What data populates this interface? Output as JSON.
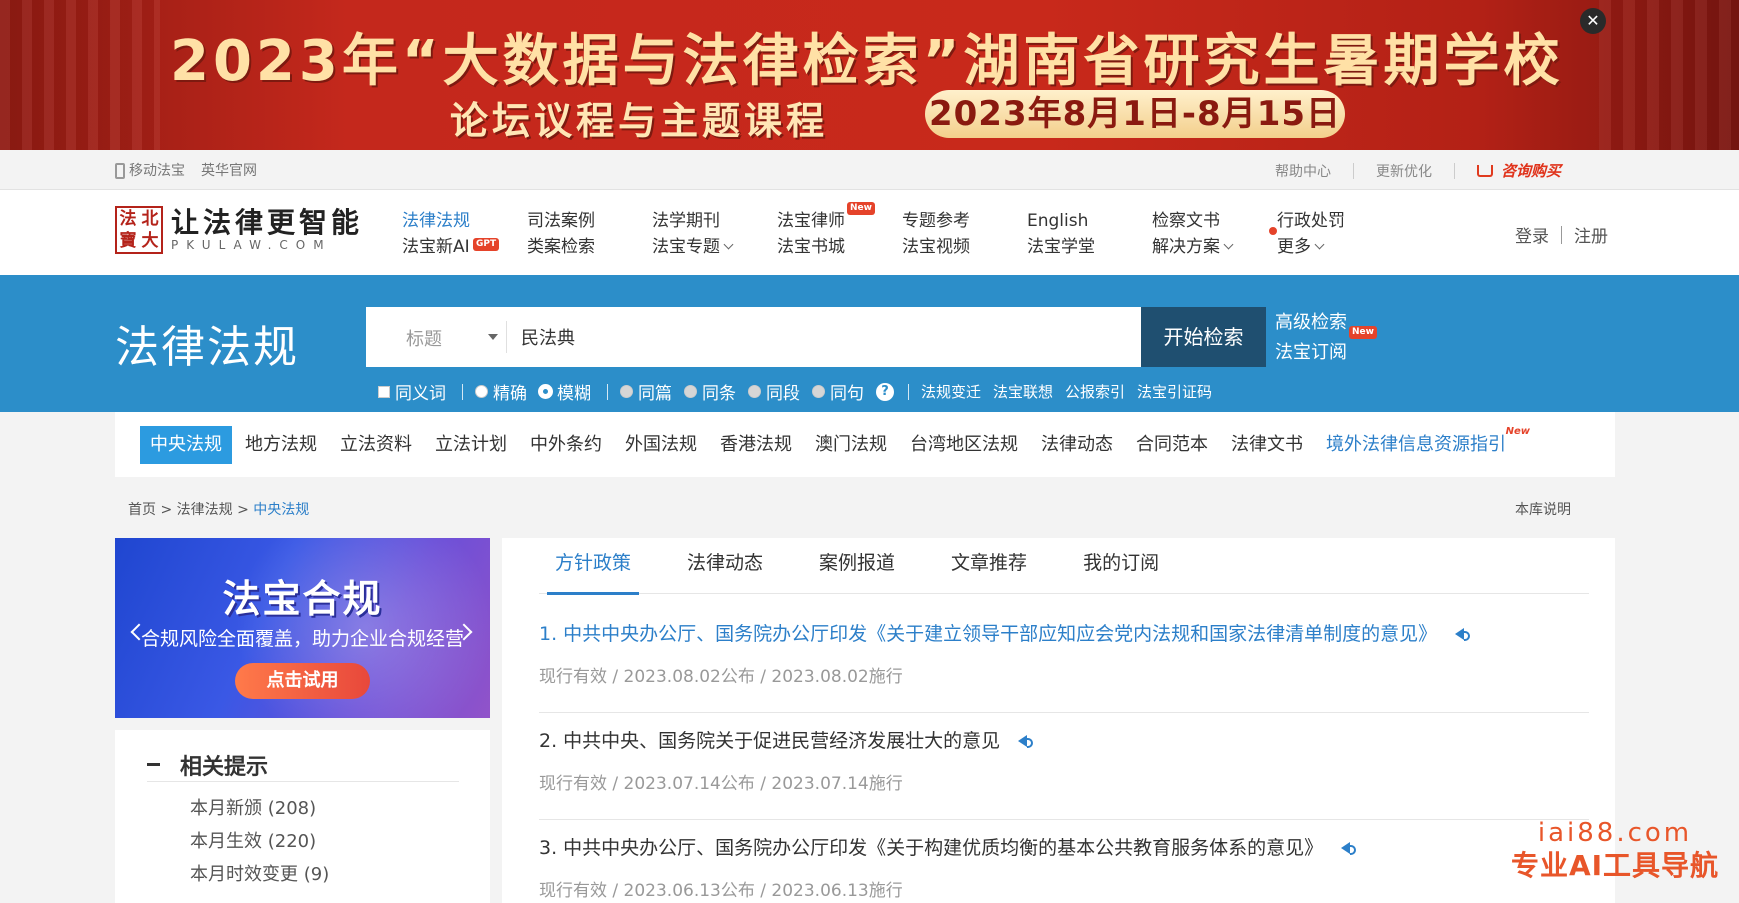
{
  "banner": {
    "title": "2023年“大数据与法律检索”湖南省研究生暑期学校",
    "subtitle": "论坛议程与主题课程",
    "date": "2023年8月1日-8月15日",
    "close_glyph": "✕"
  },
  "topbar": {
    "left_links": [
      "移动法宝",
      "英华官网"
    ],
    "help": "帮助中心",
    "update": "更新优化",
    "buy": "咨询购买"
  },
  "logo": {
    "seal_chars": [
      "法",
      "北",
      "寶",
      "大"
    ],
    "name": "让法律更智能",
    "domain": "PKULAW.COM"
  },
  "nav": [
    {
      "top": "法律法规",
      "bottom": "法宝新AI",
      "badge": "GPT"
    },
    {
      "top": "司法案例",
      "bottom": "类案检索"
    },
    {
      "top": "法学期刊",
      "bottom": "法宝专题"
    },
    {
      "top": "法宝律师",
      "bottom": "法宝书城",
      "badge": "New"
    },
    {
      "top": "专题参考",
      "bottom": "法宝视频"
    },
    {
      "top": "English",
      "bottom": "法宝学堂"
    },
    {
      "top": "检察文书",
      "bottom": "解决方案"
    },
    {
      "top": "行政处罚",
      "bottom": "更多"
    }
  ],
  "auth": {
    "login": "登录",
    "register": "注册"
  },
  "search": {
    "section_title": "法律法规",
    "field": "标题",
    "value": "民法典",
    "button": "开始检索",
    "advanced": "高级检索",
    "subscribe": "法宝订阅",
    "new_badge": "New",
    "options": {
      "synonym": "同义词",
      "exact": "精确",
      "fuzzy": "模糊",
      "same_article": "同篇",
      "same_clause": "同条",
      "same_paragraph": "同段",
      "same_sentence": "同句",
      "help": "?"
    },
    "extra_links": [
      "法规变迁",
      "法宝联想",
      "公报索引",
      "法宝引证码"
    ]
  },
  "categories": [
    "中央法规",
    "地方法规",
    "立法资料",
    "立法计划",
    "中外条约",
    "外国法规",
    "香港法规",
    "澳门法规",
    "台湾地区法规",
    "法律动态",
    "合同范本",
    "法律文书"
  ],
  "category_link": {
    "label": "境外法律信息资源指引",
    "badge": "New"
  },
  "breadcrumb": {
    "home": "首页",
    "level1": "法律法规",
    "current": "中央法规",
    "sep": ">"
  },
  "library_note": "本库说明",
  "promo": {
    "title": "法宝合规",
    "subtitle": "合规风险全面覆盖，助力企业合规经营",
    "button": "点击试用"
  },
  "hints": {
    "title": "相关提示",
    "items": [
      "本月新颁 (208)",
      "本月生效 (220)",
      "本月时效变更 (9)"
    ]
  },
  "tabs": [
    "方针政策",
    "法律动态",
    "案例报道",
    "文章推荐",
    "我的订阅"
  ],
  "items": [
    {
      "title": "1. 中共中央办公厅、国务院办公厅印发《关于建立领导干部应知应会党内法规和国家法律清单制度的意见》",
      "meta": "现行有效 / 2023.08.02公布 / 2023.08.02施行"
    },
    {
      "title": "2. 中共中央、国务院关于促进民营经济发展壮大的意见",
      "meta": "现行有效 / 2023.07.14公布 / 2023.07.14施行"
    },
    {
      "title": "3. 中共中央办公厅、国务院办公厅印发《关于构建优质均衡的基本公共教育服务体系的意见》",
      "meta": "现行有效 / 2023.06.13公布 / 2023.06.13施行"
    }
  ],
  "watermark": {
    "url": "iai88.com",
    "text": "专业AI工具导航"
  },
  "colors": {
    "primary_blue": "#2c8ec9",
    "link_blue": "#2c7fc9",
    "search_button": "#1f4f70",
    "banner_red": "#c4281c",
    "accent_red": "#e5432a"
  }
}
